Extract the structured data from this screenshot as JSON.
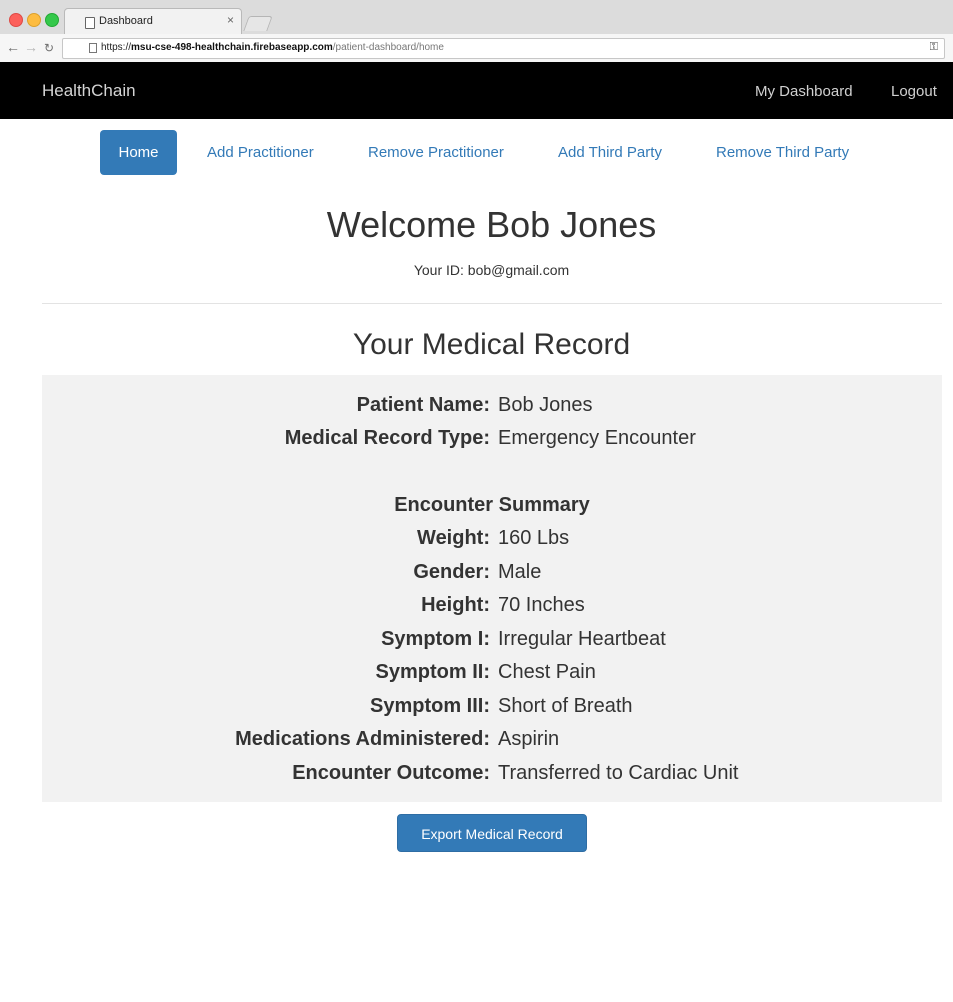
{
  "browser": {
    "tab_title": "Dashboard",
    "tab_close": "×",
    "url_scheme": "https://",
    "url_host": "msu-cse-498-healthchain.firebaseapp.com",
    "url_path": "/patient-dashboard/home",
    "icons": [
      "back-arrow-icon",
      "forward-arrow-icon",
      "reload-icon",
      "page-icon",
      "key-icon"
    ]
  },
  "navbar": {
    "brand": "HealthChain",
    "dashboard": "My Dashboard",
    "logout": "Logout"
  },
  "tabs": [
    {
      "label": "Home",
      "active": true
    },
    {
      "label": "Add Practitioner",
      "active": false
    },
    {
      "label": "Remove Practitioner",
      "active": false
    },
    {
      "label": "Add Third Party",
      "active": false
    },
    {
      "label": "Remove Third Party",
      "active": false
    }
  ],
  "welcome": {
    "title": "Welcome Bob Jones",
    "id_text": "Your ID: bob@gmail.com"
  },
  "record": {
    "heading": "Your Medical Record",
    "patient_name_label": "Patient Name:",
    "patient_name": "Bob Jones",
    "record_type_label": "Medical Record Type:",
    "record_type": "Emergency Encounter",
    "summary_heading": "Encounter Summary",
    "fields": [
      {
        "label": "Weight:",
        "value": "160 Lbs"
      },
      {
        "label": "Gender:",
        "value": "Male"
      },
      {
        "label": "Height:",
        "value": "70 Inches"
      },
      {
        "label": "Symptom I:",
        "value": "Irregular Heartbeat"
      },
      {
        "label": "Symptom II:",
        "value": "Chest Pain"
      },
      {
        "label": "Symptom III:",
        "value": "Short of Breath"
      },
      {
        "label": "Medications Administered:",
        "value": "Aspirin"
      },
      {
        "label": "Encounter Outcome:",
        "value": "Transferred to Cardiac Unit"
      }
    ]
  },
  "export_button": "Export Medical Record",
  "colors": {
    "primary": "#337ab7",
    "navbar_bg": "#000000",
    "panel_bg": "#f2f2f2"
  }
}
